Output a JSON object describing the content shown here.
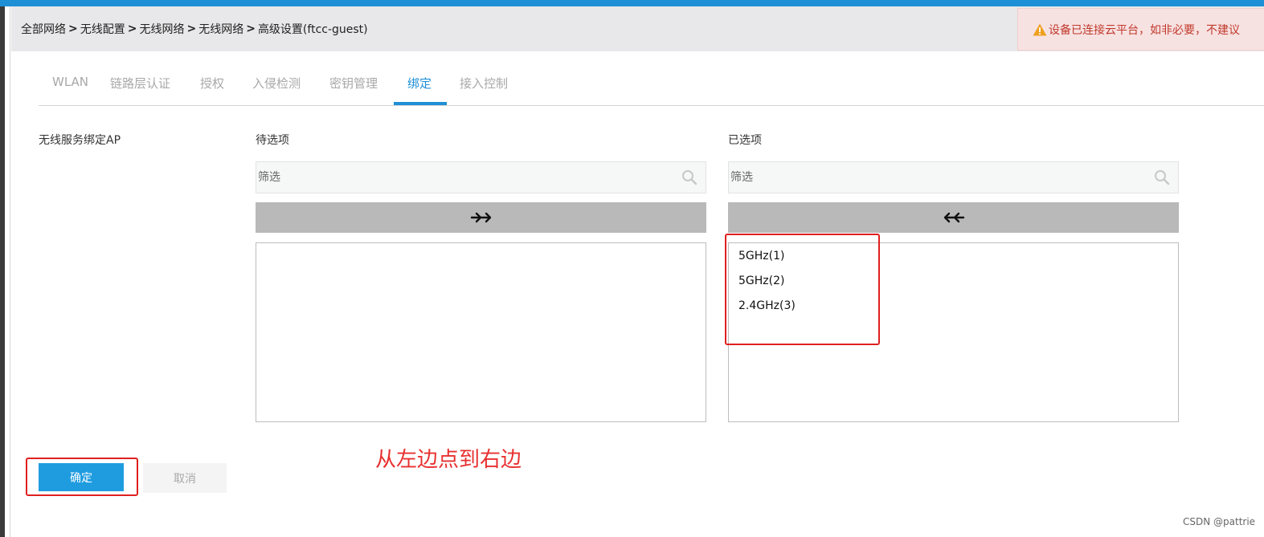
{
  "breadcrumb": {
    "items": [
      "全部网络",
      "无线配置",
      "无线网络",
      "无线网络",
      "高级设置(ftcc-guest)"
    ],
    "separator": ">"
  },
  "alert": {
    "text": "设备已连接云平台，如非必要，不建议",
    "icon": "warning-icon"
  },
  "tabs": [
    {
      "label": "WLAN",
      "active": false
    },
    {
      "label": "链路层认证",
      "active": false
    },
    {
      "label": "授权",
      "active": false
    },
    {
      "label": "入侵检测",
      "active": false
    },
    {
      "label": "密钥管理",
      "active": false
    },
    {
      "label": "绑定",
      "active": true
    },
    {
      "label": "接入控制",
      "active": false
    }
  ],
  "form": {
    "field_label": "无线服务绑定AP",
    "available": {
      "title": "待选项",
      "filter_placeholder": "筛选",
      "move_button": "➔➔",
      "items": []
    },
    "selected": {
      "title": "已选项",
      "filter_placeholder": "筛选",
      "move_button": "⬅⬅",
      "items": [
        "5GHz(1)",
        "5GHz(2)",
        "2.4GHz(3)"
      ]
    }
  },
  "annotation": "从左边点到右边",
  "buttons": {
    "ok": "确定",
    "cancel": "取消"
  },
  "watermark": "CSDN @pattrie",
  "colors": {
    "accent": "#1f8fd6",
    "annotation_red": "#e02020",
    "alert_text": "#c0392b"
  }
}
